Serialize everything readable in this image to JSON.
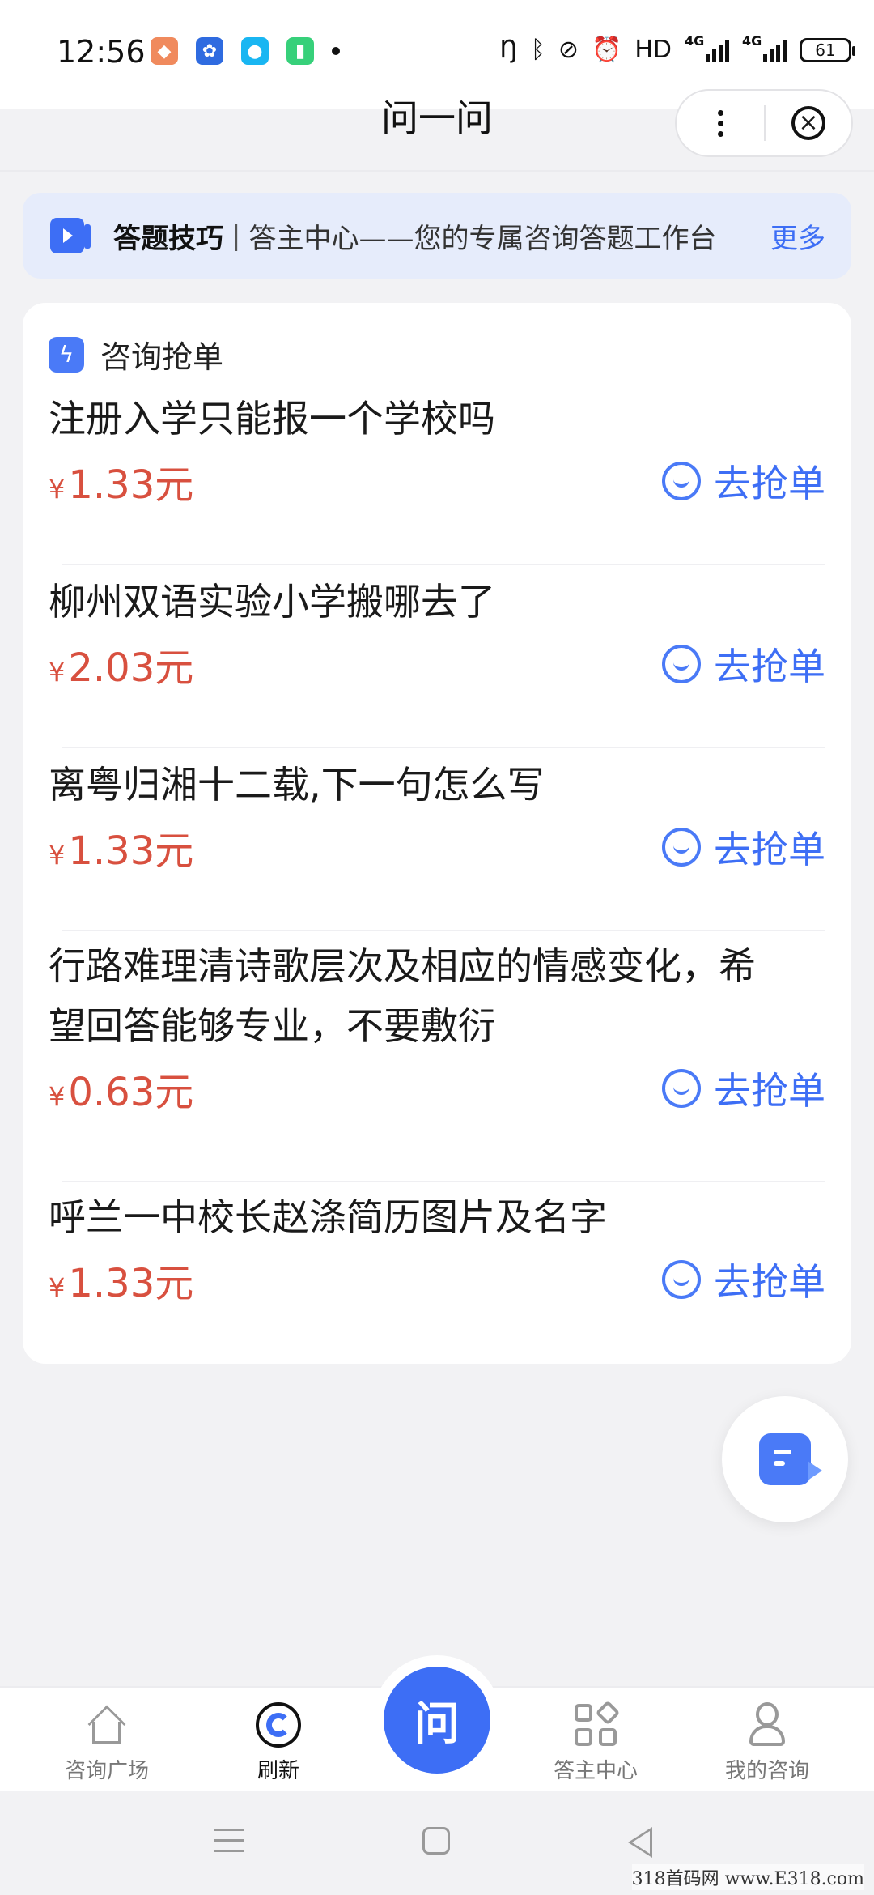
{
  "status_bar": {
    "time": "12:56",
    "network_label_1": "4G",
    "network_label_2": "4G",
    "hd_label": "HD",
    "battery": "61"
  },
  "nav": {
    "title": "问一问"
  },
  "banner": {
    "tag": "答题技巧",
    "separator": "|",
    "text": "答主中心——您的专属咨询答题工作台",
    "more": "更多"
  },
  "card": {
    "title": "咨询抢单",
    "items": [
      {
        "question": "注册入学只能报一个学校吗",
        "currency": "¥",
        "price": "1.33元",
        "action": "去抢单"
      },
      {
        "question": "柳州双语实验小学搬哪去了",
        "currency": "¥",
        "price": "2.03元",
        "action": "去抢单"
      },
      {
        "question": "离粤归湘十二载,下一句怎么写",
        "currency": "¥",
        "price": "1.33元",
        "action": "去抢单"
      },
      {
        "question": "行路难理清诗歌层次及相应的情感变化，希望回答能够专业，不要敷衍",
        "currency": "¥",
        "price": "0.63元",
        "action": "去抢单"
      },
      {
        "question": "呼兰一中校长赵涤简历图片及名字",
        "currency": "¥",
        "price": "1.33元",
        "action": "去抢单"
      }
    ]
  },
  "tabbar": {
    "tabs": [
      {
        "label": "咨询广场",
        "icon": "home-icon"
      },
      {
        "label": "刷新",
        "icon": "refresh-icon"
      },
      {
        "label": "答主中心",
        "icon": "grid-icon"
      },
      {
        "label": "我的咨询",
        "icon": "user-icon"
      }
    ],
    "center_label": "问"
  },
  "watermark": "318首码网 www.E318.com",
  "colors": {
    "accent": "#3d6ef5",
    "price": "#d8503f",
    "banner_bg": "#e6ecfb",
    "page_bg": "#f2f2f4"
  }
}
